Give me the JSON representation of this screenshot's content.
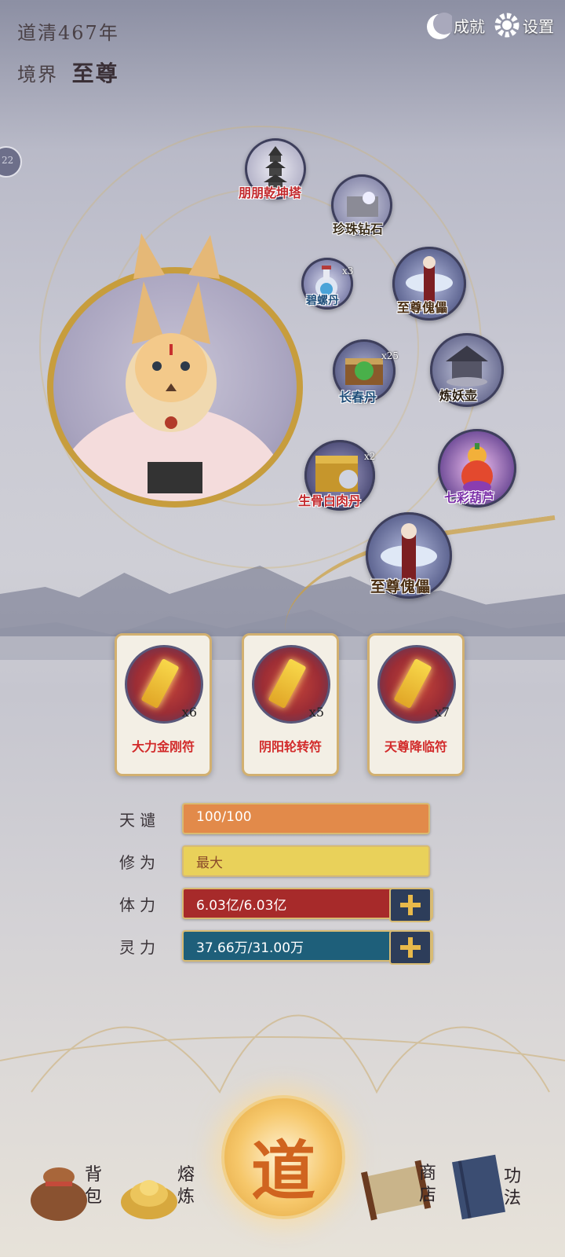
{
  "header": {
    "era_label": "道清",
    "year": "467",
    "year_suffix": "年",
    "realm_label": "境界",
    "realm_value": "至尊"
  },
  "top_buttons": {
    "achievements": "成就",
    "settings": "设置"
  },
  "side_badge": "22",
  "items": [
    {
      "name": "朋朋乾坤塔"
    },
    {
      "name": "珍珠钻石"
    },
    {
      "name": "碧螺丹",
      "qty": "x3"
    },
    {
      "name": "至尊傀儡"
    },
    {
      "name": "长春丹",
      "qty": "x25"
    },
    {
      "name": "炼妖壶"
    },
    {
      "name": "生骨白肉丹",
      "qty": "x2"
    },
    {
      "name": "七彩葫芦"
    },
    {
      "name": "至尊傀儡"
    }
  ],
  "talismans": [
    {
      "name": "大力金刚符",
      "qty": "x6"
    },
    {
      "name": "阴阳轮转符",
      "qty": "x5"
    },
    {
      "name": "天尊降临符",
      "qty": "x7"
    }
  ],
  "stats": {
    "tiandao": {
      "label": "天谴",
      "value": "100/100",
      "fill": 1.0,
      "color": "#e28a4a"
    },
    "xiuwei": {
      "label": "修为",
      "value": "最大",
      "fill": 1.0,
      "color": "#e9d15a"
    },
    "tili": {
      "label": "体力",
      "value": "6.03亿/6.03亿",
      "fill": 1.0,
      "color": "#a72a2a"
    },
    "lingli": {
      "label": "灵力",
      "value": "37.66万/31.00万",
      "fill": 1.0,
      "color": "#1e5f7a"
    }
  },
  "bottom_nav": {
    "bag": "背包",
    "refine": "熔炼",
    "dao": "道",
    "shop": "商店",
    "skills": "功法"
  }
}
